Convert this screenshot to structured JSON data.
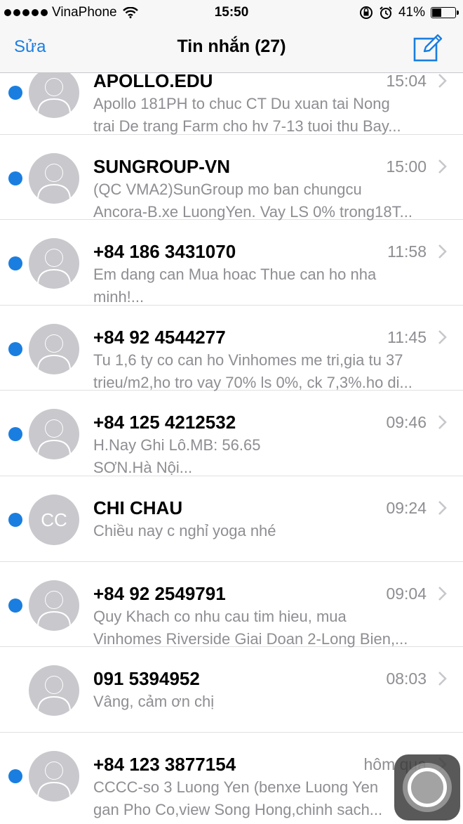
{
  "status_bar": {
    "carrier": "VinaPhone",
    "time": "15:50",
    "battery_percent": "41%",
    "battery_level": 0.41,
    "icons": [
      "signal-dots-icon",
      "wifi-icon",
      "rotation-lock-icon",
      "alarm-icon",
      "battery-icon"
    ]
  },
  "nav": {
    "edit_label": "Sửa",
    "title": "Tin nhắn (27)",
    "compose_icon": "compose-icon"
  },
  "accent_color": "#1a7ee0",
  "conversations": [
    {
      "sender": "APOLLO.EDU",
      "time": "15:04",
      "preview": [
        "Apollo 181PH to chuc CT Du xuan tai Nong",
        "trai De trang Farm cho hv 7-13 tuoi thu Bay..."
      ],
      "unread": true,
      "avatar": "person-icon"
    },
    {
      "sender": "SUNGROUP-VN",
      "time": "15:00",
      "preview": [
        "(QC VMA2)SunGroup mo ban chungcu",
        "Ancora-B.xe LuongYen. Vay LS 0% trong18T..."
      ],
      "unread": true,
      "avatar": "person-icon"
    },
    {
      "sender": "+84 186 3431070",
      "time": "11:58",
      "preview": [
        "Em dang can Mua hoac Thue can ho nha",
        "minh!..."
      ],
      "unread": true,
      "avatar": "person-icon"
    },
    {
      "sender": "+84 92 4544277",
      "time": "11:45",
      "preview": [
        "Tu 1,6 ty co can ho Vinhomes me tri,gia tu 37",
        "trieu/m2,ho tro vay 70% ls 0%, ck 7,3%.ho di..."
      ],
      "unread": true,
      "avatar": "person-icon"
    },
    {
      "sender": "+84 125 4212532",
      "time": "09:46",
      "preview": [
        "H.Nay Ghi Lô.MB: 56.65",
        "SƠN.Hà Nội..."
      ],
      "unread": true,
      "avatar": "person-icon"
    },
    {
      "sender": "CHI CHAU",
      "time": "09:24",
      "preview": [
        "Chiều nay c nghỉ yoga nhé"
      ],
      "unread": true,
      "avatar": "initials",
      "initials": "CC"
    },
    {
      "sender": "+84 92 2549791",
      "time": "09:04",
      "preview": [
        "Quy Khach co nhu cau tim hieu, mua",
        "Vinhomes Riverside Giai Doan 2-Long Bien,..."
      ],
      "unread": true,
      "avatar": "person-icon"
    },
    {
      "sender": "091 5394952",
      "time": "08:03",
      "preview": [
        "Vâng, cảm ơn chị"
      ],
      "unread": false,
      "avatar": "person-icon"
    },
    {
      "sender": "+84 123 3877154",
      "time": "hôm qua",
      "preview": [
        "CCCC-so 3 Luong Yen (benxe Luong Yen",
        "gan Pho Co,view Song Hong,chinh sach..."
      ],
      "unread": true,
      "avatar": "person-icon"
    }
  ],
  "assistive_touch_icon": "assistive-touch-icon"
}
